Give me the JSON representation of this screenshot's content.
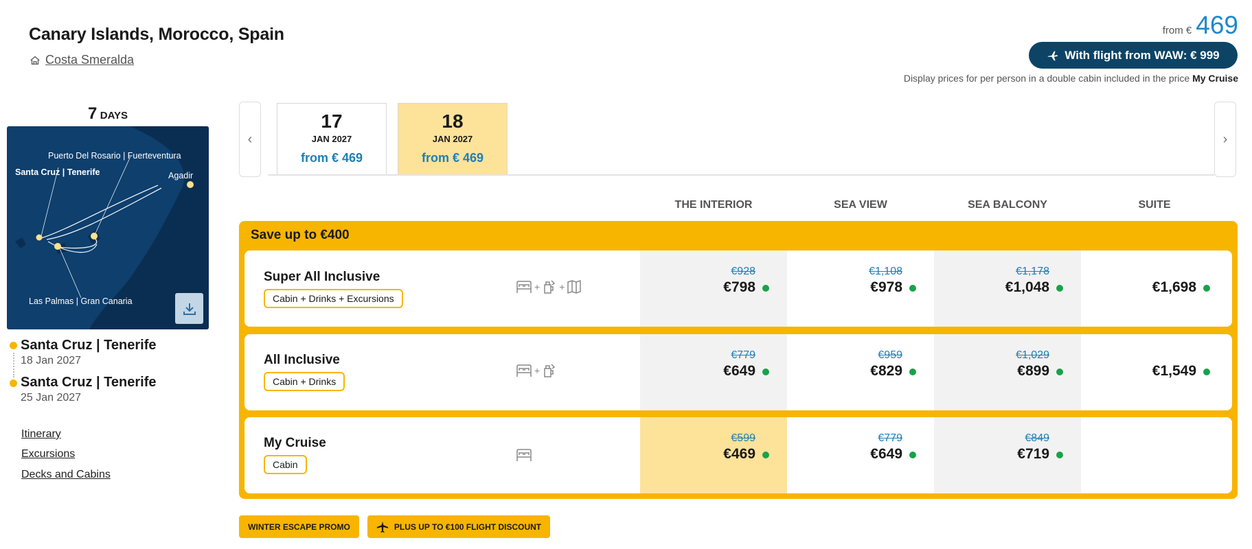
{
  "header": {
    "title": "Canary Islands, Morocco, Spain",
    "ship_name": "Costa Smeralda",
    "from_label": "from €",
    "from_price": "469",
    "flight_button_label": "With flight from WAW: € 999",
    "disclaimer_text": "Display prices for per person in a double cabin included in the price",
    "disclaimer_bold": "My Cruise"
  },
  "itinerary": {
    "days_count": "7",
    "days_unit": "DAYS",
    "map_labels": {
      "fuerteventura": "Puerto Del Rosario | Fuerteventura",
      "tenerife": "Santa Cruz | Tenerife",
      "agadir": "Agadir",
      "gran_canaria": "Las Palmas | Gran Canaria"
    },
    "start_port": "Santa Cruz | Tenerife",
    "start_date": "18 Jan 2027",
    "end_port": "Santa Cruz | Tenerife",
    "end_date": "25 Jan 2027",
    "links": [
      "Itinerary",
      "Excursions",
      "Decks and Cabins"
    ]
  },
  "dates": [
    {
      "day": "17",
      "month": "JAN 2027",
      "price": "from € 469",
      "selected": false
    },
    {
      "day": "18",
      "month": "JAN 2027",
      "price": "from € 469",
      "selected": true
    }
  ],
  "columns": [
    "THE INTERIOR",
    "SEA VIEW",
    "SEA BALCONY",
    "SUITE"
  ],
  "promo": {
    "title": "Save up to €400",
    "packages": [
      {
        "name": "Super All Inclusive",
        "badge": "Cabin + Drinks + Excursions",
        "icons": [
          "bed-icon",
          "drink-icon",
          "map-icon"
        ],
        "prices": [
          {
            "old": "€928",
            "now": "€798"
          },
          {
            "old": "€1,108",
            "now": "€978"
          },
          {
            "old": "€1,178",
            "now": "€1,048"
          },
          {
            "old": "",
            "now": "€1,698"
          }
        ]
      },
      {
        "name": "All Inclusive",
        "badge": "Cabin + Drinks",
        "icons": [
          "bed-icon",
          "drink-icon"
        ],
        "prices": [
          {
            "old": "€779",
            "now": "€649"
          },
          {
            "old": "€959",
            "now": "€829"
          },
          {
            "old": "€1,029",
            "now": "€899"
          },
          {
            "old": "",
            "now": "€1,549"
          }
        ]
      },
      {
        "name": "My Cruise",
        "badge": "Cabin",
        "icons": [
          "bed-icon"
        ],
        "prices": [
          {
            "old": "€599",
            "now": "€469"
          },
          {
            "old": "€779",
            "now": "€649"
          },
          {
            "old": "€849",
            "now": "€719"
          },
          {
            "old": "",
            "now": ""
          }
        ]
      }
    ]
  },
  "chips": [
    "WINTER ESCAPE PROMO",
    "PLUS UP TO €100 FLIGHT DISCOUNT"
  ],
  "colors": {
    "accent_yellow": "#f7b500",
    "highlight_yellow": "#fde299",
    "navy": "#0d4466",
    "price_blue": "#1e88c9",
    "availability_green": "#17a34a"
  }
}
